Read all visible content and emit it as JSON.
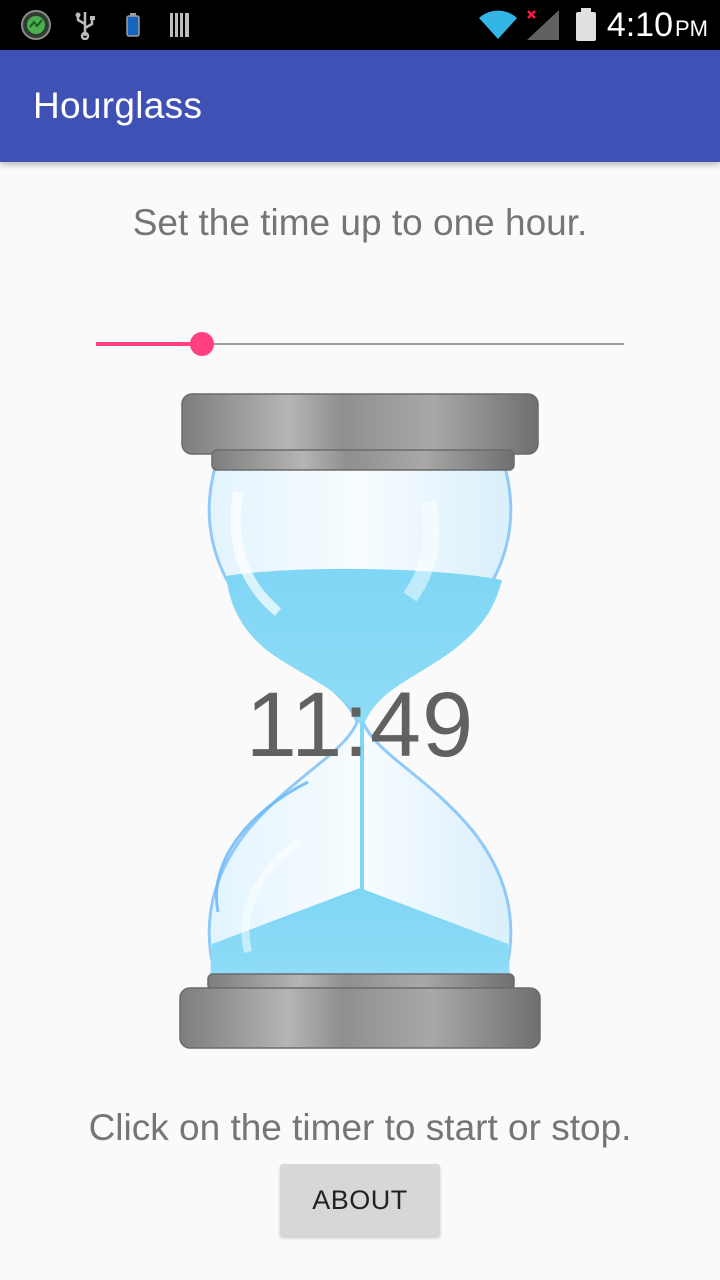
{
  "status_bar": {
    "time": "4:10",
    "ampm": "PM",
    "icons": [
      "app-notification-icon",
      "usb-icon",
      "battery-small-icon",
      "barcode-icon",
      "wifi-icon",
      "signal-no-service-icon",
      "battery-icon"
    ]
  },
  "app_bar": {
    "title": "Hourglass"
  },
  "main": {
    "instruction": "Set the time up to one hour.",
    "slider_value_fraction": 0.2,
    "timer": "11:49",
    "hint": "Click on the timer to start or stop.",
    "about_label": "ABOUT"
  },
  "colors": {
    "primary": "#3f51b5",
    "accent": "#ff4081",
    "sand": "#81d4fa",
    "text_secondary": "#757575"
  }
}
